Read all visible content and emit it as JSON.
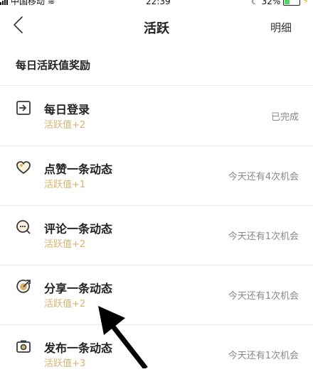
{
  "status_bar": {
    "carrier": "中国移动",
    "time": "22:39",
    "battery": "32%"
  },
  "nav": {
    "title": "活跃",
    "detail": "明细"
  },
  "section": {
    "title": "每日活跃值奖励"
  },
  "tasks": [
    {
      "icon": "login-icon",
      "name": "每日登录",
      "reward": "活跃值+2",
      "status": "已完成"
    },
    {
      "icon": "heart-icon",
      "name": "点赞一条动态",
      "reward": "活跃值+1",
      "status": "今天还有4次机会"
    },
    {
      "icon": "comment-icon",
      "name": "评论一条动态",
      "reward": "活跃值+2",
      "status": "今天还有1次机会"
    },
    {
      "icon": "share-icon",
      "name": "分享一条动态",
      "reward": "活跃值+2",
      "status": "今天还有1次机会"
    },
    {
      "icon": "camera-icon",
      "name": "发布一条动态",
      "reward": "活跃值+3",
      "status": "今天还有1次机会"
    }
  ],
  "colors": {
    "accent": "#d9b36a",
    "icon": "#3a3a3a",
    "divider": "#ececec"
  }
}
